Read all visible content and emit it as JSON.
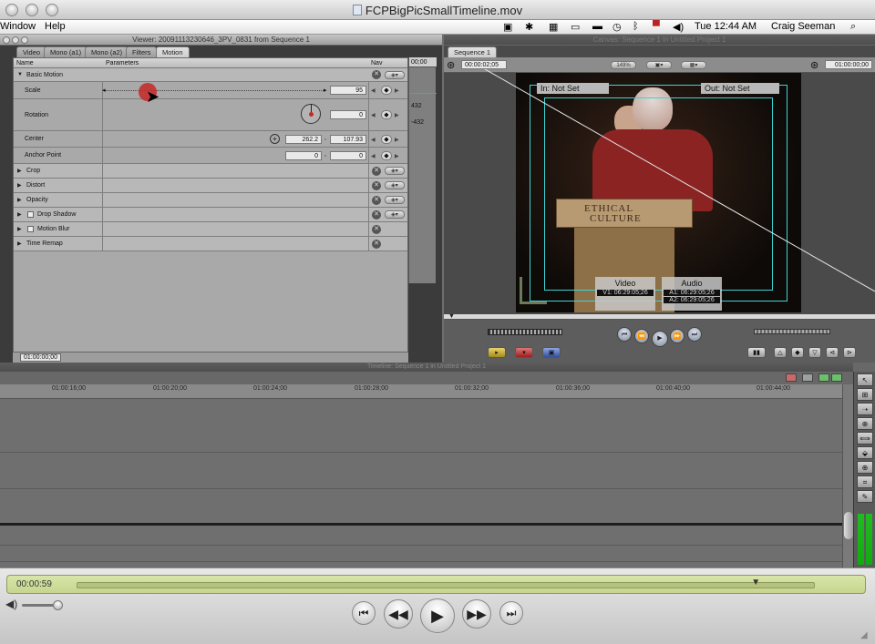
{
  "qt_window": {
    "title": "FCPBigPicSmallTimeline.mov"
  },
  "menubar": {
    "items": [
      "Window",
      "Help"
    ],
    "clock": "Tue 12:44 AM",
    "user": "Craig Seeman"
  },
  "viewer": {
    "title": "Viewer: 20091113230646_3PV_0831 from Sequence 1",
    "tabs": [
      "Video",
      "Mono (a1)",
      "Mono (a2)",
      "Filters",
      "Motion"
    ],
    "active_tab": "Motion",
    "columns": {
      "name": "Name",
      "parameters": "Parameters",
      "nav": "Nav"
    },
    "timecode_header": "00;00",
    "footer_timecode": "01:00:00;00",
    "rows": {
      "basic_motion": "Basic Motion",
      "scale": {
        "label": "Scale",
        "value": "95",
        "slider_fraction": 0.2
      },
      "rotation": {
        "label": "Rotation",
        "value": "0",
        "kf_top": "432",
        "kf_bottom": "-432"
      },
      "center": {
        "label": "Center",
        "x": "262.2",
        "y": "107.93",
        "sep": ","
      },
      "anchor": {
        "label": "Anchor Point",
        "x": "0",
        "y": "0",
        "sep": ","
      },
      "crop": "Crop",
      "distort": "Distort",
      "opacity": "Opacity",
      "drop_shadow": "Drop Shadow",
      "motion_blur": "Motion Blur",
      "time_remap": "Time Remap"
    }
  },
  "canvas": {
    "title": "Canvas: Sequence 1 in Untitled Project 1",
    "tab": "Sequence 1",
    "timecode_left": "00:00:02;05",
    "zoom": "149%",
    "timecode_right": "01:00:00;00",
    "in_label": "In: Not Set",
    "out_label": "Out: Not Set",
    "video_label": "Video",
    "video_tc": "V1: 06:29:05;26",
    "audio_label": "Audio",
    "audio_tc_1": "A1: 06:29:05;26",
    "audio_tc_2": "A2: 06:29:05;26",
    "sign_text_1": "ETHICAL",
    "sign_text_2": "CULTURE"
  },
  "timeline": {
    "title": "Timeline: Sequence 1 in Untitled Project 1",
    "ticks": [
      "01:00:16;00",
      "01:00:20;00",
      "01:00:24;00",
      "01:00:28;00",
      "01:00:32;00",
      "01:00:36;00",
      "01:00:40;00",
      "01:00:44;00"
    ]
  },
  "qt_controller": {
    "time": "00:00:59",
    "playhead_fraction": 0.92
  },
  "colors": {
    "safe_area": "#3fd3d3",
    "lcd": "#c6d68f",
    "cursor_dot": "#c62828"
  }
}
